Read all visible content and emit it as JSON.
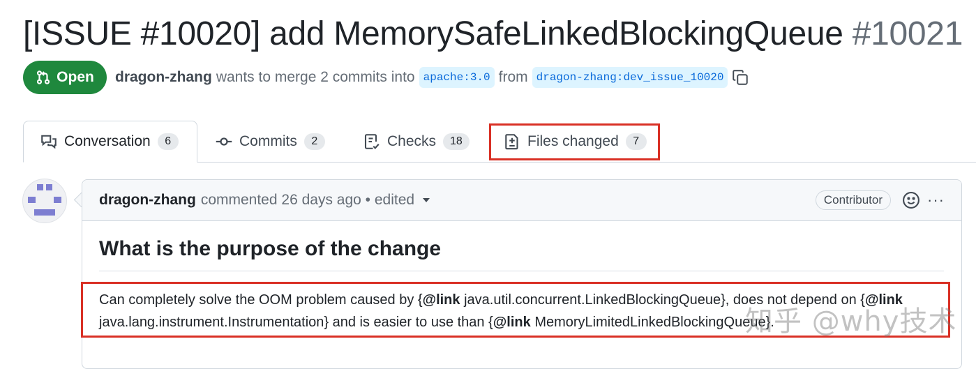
{
  "pr": {
    "title": "[ISSUE #10020] add MemorySafeLinkedBlockingQueue",
    "number": "#10021",
    "state": "Open",
    "author": "dragon-zhang",
    "merge_text": "wants to merge 2 commits into",
    "base_branch": "apache:3.0",
    "from_text": "from",
    "head_branch": "dragon-zhang:dev_issue_10020"
  },
  "tabs": [
    {
      "label": "Conversation",
      "count": "6"
    },
    {
      "label": "Commits",
      "count": "2"
    },
    {
      "label": "Checks",
      "count": "18"
    },
    {
      "label": "Files changed",
      "count": "7"
    }
  ],
  "comment": {
    "author": "dragon-zhang",
    "action": "commented",
    "time": "26 days ago",
    "separator": "•",
    "edited": "edited",
    "role_badge": "Contributor",
    "more": "···",
    "heading": "What is the purpose of the change",
    "body": {
      "t1": "Can completely solve the OOM problem caused by {",
      "link1": "@link",
      "t2": " java.util.concurrent.LinkedBlockingQueue}, does not depend on {",
      "link2": "@link",
      "t3": " java.lang.instrument.Instrumentation} and is easier to use than {",
      "link3": "@link",
      "t4": " MemoryLimitedLinkedBlockingQueue}."
    }
  },
  "watermark": "知乎 @why技术",
  "colors": {
    "open_green": "#1f883d",
    "branch_bg": "#ddf4ff",
    "branch_fg": "#0969da",
    "highlight_red": "#d93025"
  },
  "icons": [
    "git-pull-request-icon",
    "copy-icon",
    "comment-discussion-icon",
    "git-commit-icon",
    "checklist-icon",
    "file-diff-icon",
    "smiley-icon",
    "kebab-horizontal-icon"
  ]
}
